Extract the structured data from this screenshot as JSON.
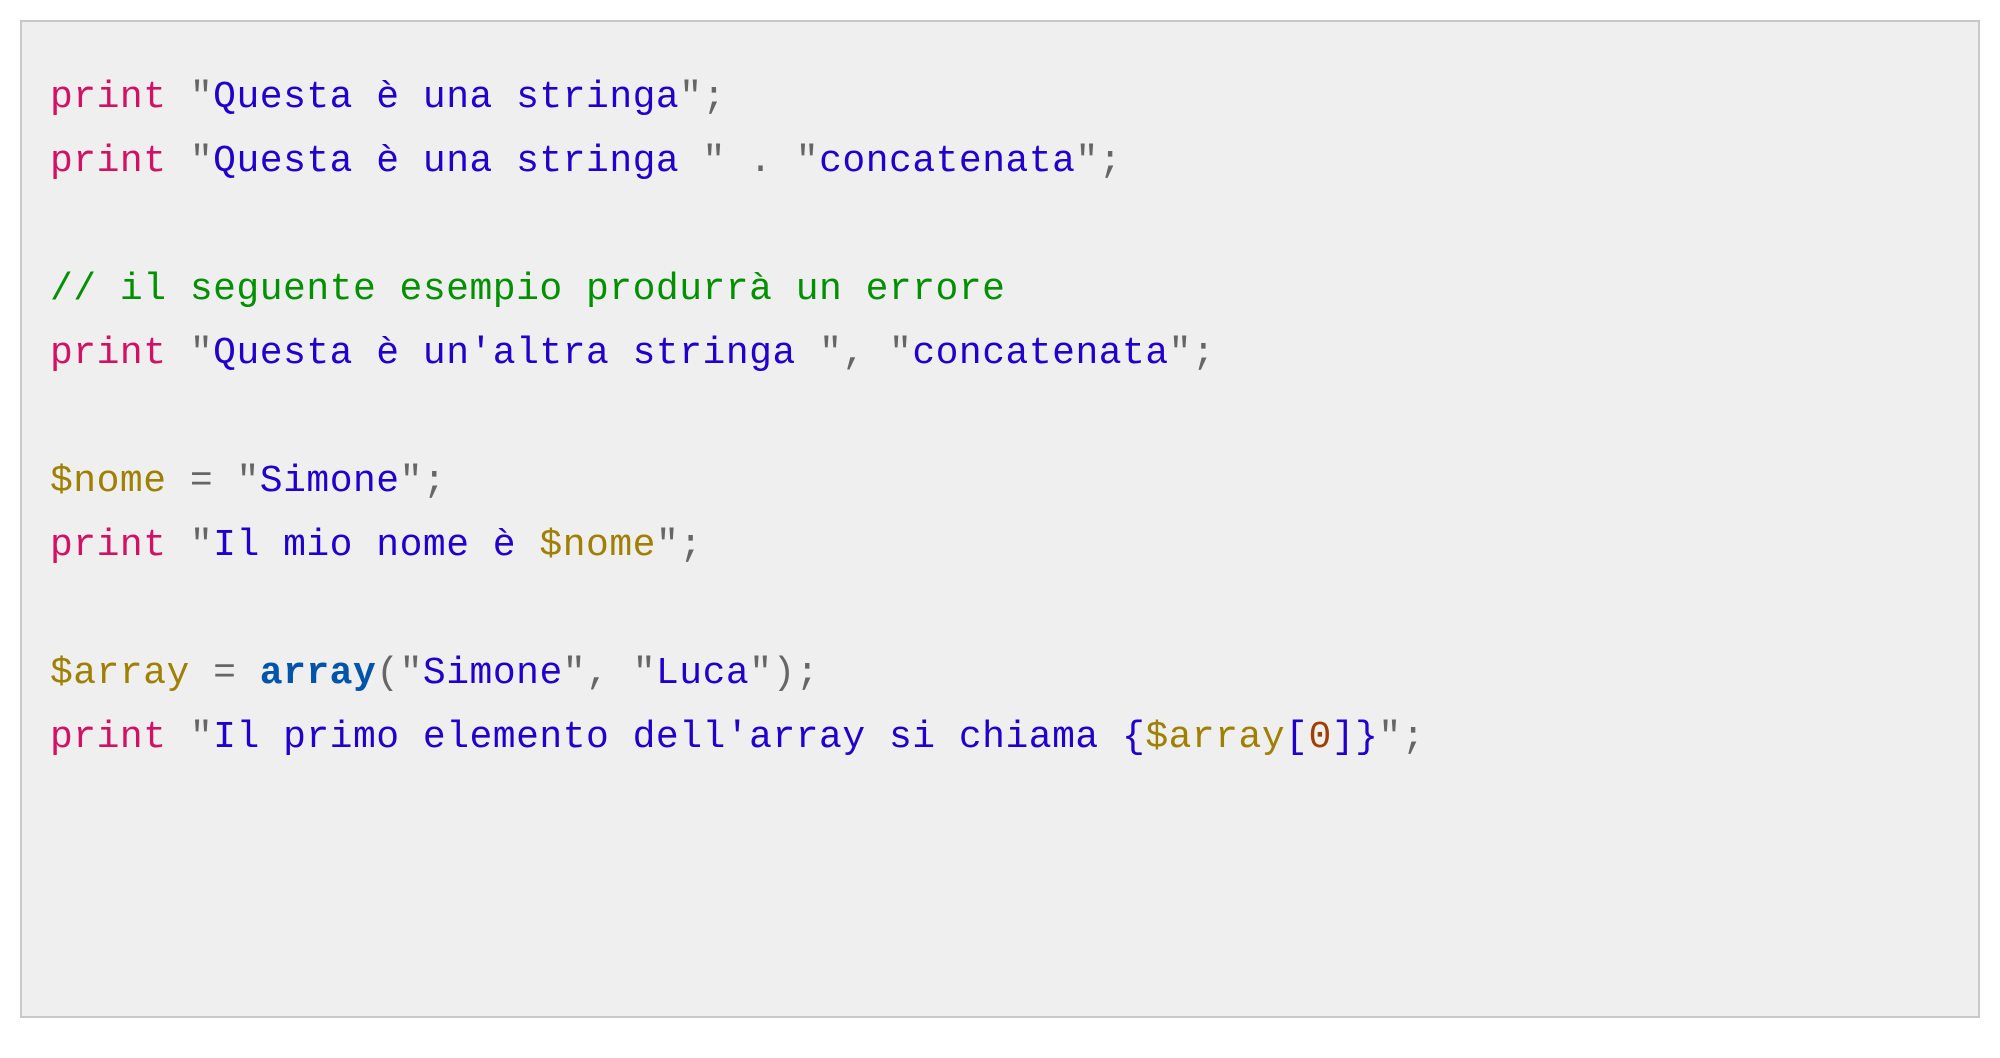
{
  "code": {
    "line1": {
      "print": "print",
      "str": "Questa è una stringa"
    },
    "line2": {
      "print": "print",
      "str1": "Questa è una stringa ",
      "str2": "concatenata"
    },
    "line3": {
      "comment": "// il seguente esempio produrrà un errore"
    },
    "line4": {
      "print": "print",
      "str1": "Questa è un'altra stringa ",
      "str2": "concatenata"
    },
    "line5": {
      "var": "$nome",
      "str": "Simone"
    },
    "line6": {
      "print": "print",
      "str_a": "Il mio nome è ",
      "var": "$nome"
    },
    "line7": {
      "var": "$array",
      "func": "array",
      "str1": "Simone",
      "str2": "Luca"
    },
    "line8": {
      "print": "print",
      "str_a": "Il primo elemento dell'array si chiama ",
      "brace_l": "{",
      "var": "$array",
      "brack_l": "[",
      "num": "0",
      "brack_r": "]",
      "brace_r": "}"
    }
  }
}
